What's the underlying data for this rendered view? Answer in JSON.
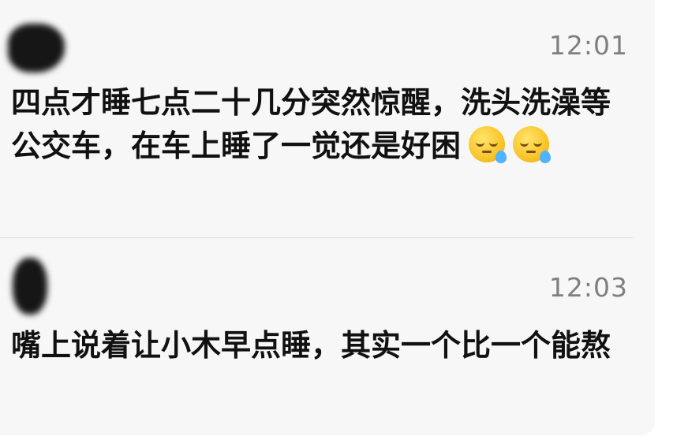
{
  "messages": [
    {
      "time": "12:01",
      "text": "四点才睡七点二十几分突然惊醒，洗头洗澡等公交车，在车上睡了一觉还是好困",
      "emojis": [
        "sleepy-face-icon",
        "sleepy-face-icon"
      ]
    },
    {
      "time": "12:03",
      "text": "嘴上说着让小木早点睡，其实一个比一个能熬"
    }
  ],
  "colors": {
    "card_background": "#f7f7f7",
    "text": "#111111",
    "timestamp": "#7f7f7f",
    "divider": "#dcdcdc"
  }
}
